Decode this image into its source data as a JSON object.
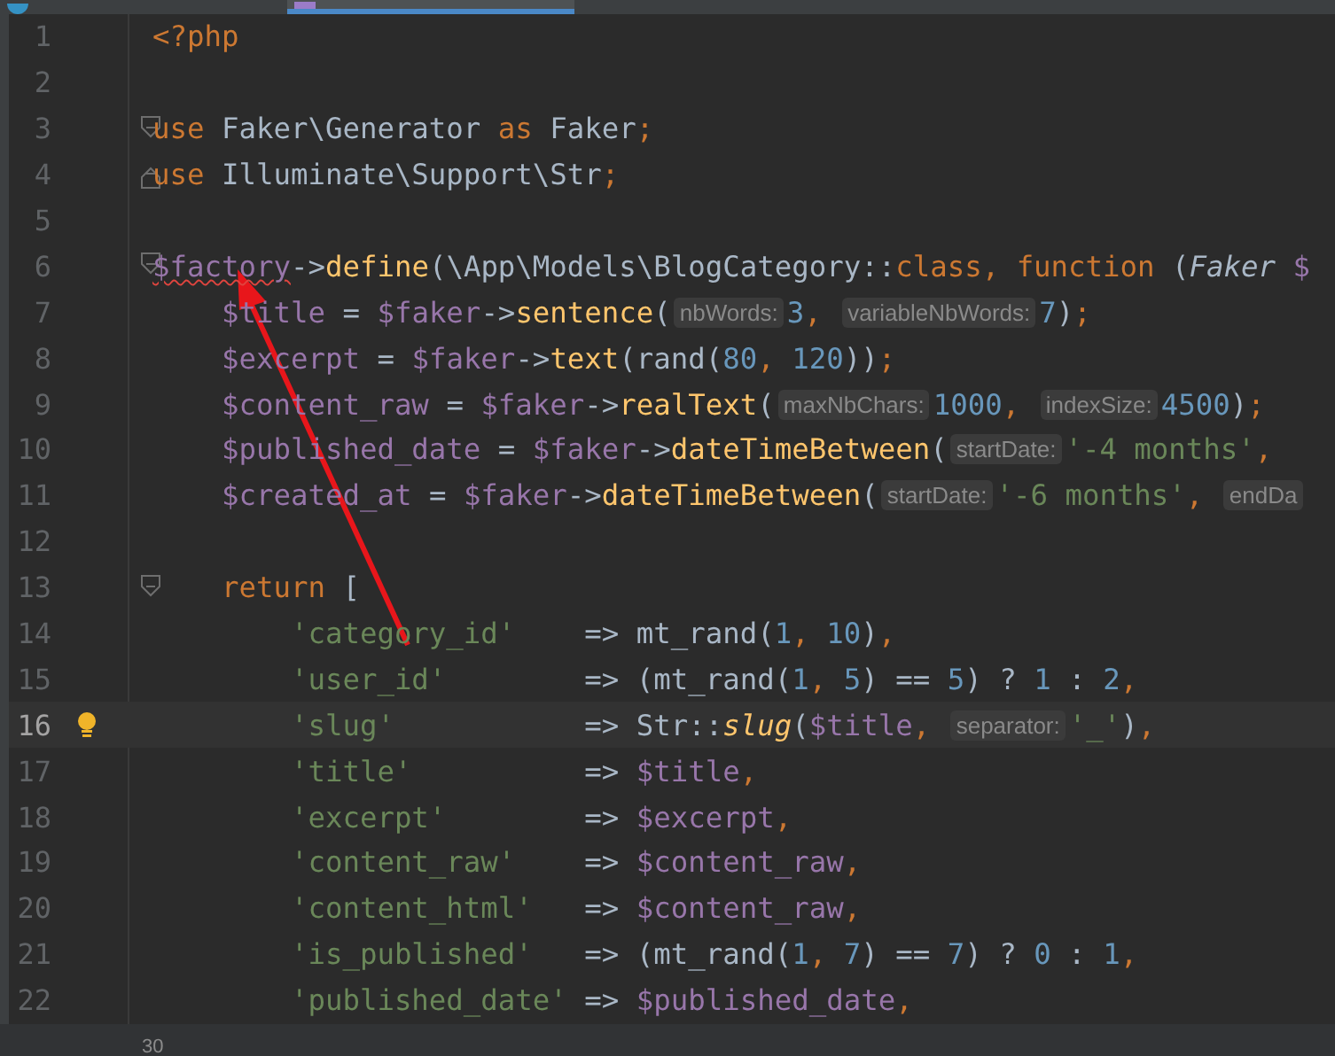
{
  "tabs": [
    {
      "selected": false
    },
    {
      "selected": true
    }
  ],
  "lines": [
    {
      "number": "1",
      "current": false,
      "bulb": false,
      "fold_open": false,
      "fold_close": false,
      "parts": [
        {
          "kind": "kw",
          "t": "<?php"
        }
      ]
    },
    {
      "number": "2",
      "current": false,
      "bulb": false,
      "fold_open": false,
      "fold_close": false
    },
    {
      "number": "3",
      "current": false,
      "bulb": false,
      "fold_open": true,
      "fold_close": false,
      "parts": [
        {
          "kind": "kw",
          "t": "use "
        },
        {
          "kind": "plain",
          "t": "Faker\\Generator "
        },
        {
          "kind": "kw",
          "t": "as "
        },
        {
          "kind": "plain",
          "t": "Faker"
        },
        {
          "kind": "kw",
          "t": ";"
        }
      ]
    },
    {
      "number": "4",
      "current": false,
      "bulb": false,
      "fold_open": false,
      "fold_close": true,
      "parts": [
        {
          "kind": "kw",
          "t": "use "
        },
        {
          "kind": "plain",
          "t": "Illuminate\\Support\\Str"
        },
        {
          "kind": "kw",
          "t": ";"
        }
      ]
    },
    {
      "number": "5",
      "current": false,
      "bulb": false,
      "fold_open": false,
      "fold_close": false
    },
    {
      "number": "6",
      "current": false,
      "bulb": false,
      "fold_open": true,
      "fold_close": false,
      "parts": [
        {
          "kind": "var",
          "t": "$factory",
          "error": true
        },
        {
          "kind": "plain",
          "t": "->"
        },
        {
          "kind": "func",
          "t": "define"
        },
        {
          "kind": "plain",
          "t": "(\\App\\Models\\BlogCategory::"
        },
        {
          "kind": "kw",
          "t": "class, function "
        },
        {
          "kind": "plain",
          "t": "("
        },
        {
          "kind": "class",
          "t": "Faker "
        },
        {
          "kind": "var",
          "t": "$"
        }
      ]
    },
    {
      "number": "7",
      "current": false,
      "bulb": false,
      "fold_open": false,
      "fold_close": false,
      "parts": [
        {
          "kind": "var",
          "t": "    $title "
        },
        {
          "kind": "plain",
          "t": "= "
        },
        {
          "kind": "var",
          "t": "$faker"
        },
        {
          "kind": "plain",
          "t": "->"
        },
        {
          "kind": "func",
          "t": "sentence"
        },
        {
          "kind": "plain",
          "t": "("
        },
        {
          "kind": "hint",
          "t": "nbWords:"
        },
        {
          "kind": "num",
          "t": "3"
        },
        {
          "kind": "kw",
          "t": ", "
        },
        {
          "kind": "hint",
          "t": "variableNbWords:"
        },
        {
          "kind": "num",
          "t": "7"
        },
        {
          "kind": "plain",
          "t": ")"
        },
        {
          "kind": "kw",
          "t": ";"
        }
      ]
    },
    {
      "number": "8",
      "current": false,
      "bulb": false,
      "fold_open": false,
      "fold_close": false,
      "parts": [
        {
          "kind": "var",
          "t": "    $excerpt "
        },
        {
          "kind": "plain",
          "t": "= "
        },
        {
          "kind": "var",
          "t": "$faker"
        },
        {
          "kind": "plain",
          "t": "->"
        },
        {
          "kind": "func",
          "t": "text"
        },
        {
          "kind": "plain",
          "t": "(rand("
        },
        {
          "kind": "num",
          "t": "80"
        },
        {
          "kind": "kw",
          "t": ", "
        },
        {
          "kind": "num",
          "t": "120"
        },
        {
          "kind": "plain",
          "t": "))"
        },
        {
          "kind": "kw",
          "t": ";"
        }
      ]
    },
    {
      "number": "9",
      "current": false,
      "bulb": false,
      "fold_open": false,
      "fold_close": false,
      "parts": [
        {
          "kind": "var",
          "t": "    $content_raw "
        },
        {
          "kind": "plain",
          "t": "= "
        },
        {
          "kind": "var",
          "t": "$faker"
        },
        {
          "kind": "plain",
          "t": "->"
        },
        {
          "kind": "func",
          "t": "realText"
        },
        {
          "kind": "plain",
          "t": "("
        },
        {
          "kind": "hint",
          "t": "maxNbChars:"
        },
        {
          "kind": "num",
          "t": "1000"
        },
        {
          "kind": "kw",
          "t": ", "
        },
        {
          "kind": "hint",
          "t": "indexSize:"
        },
        {
          "kind": "num",
          "t": "4500"
        },
        {
          "kind": "plain",
          "t": ")"
        },
        {
          "kind": "kw",
          "t": ";"
        }
      ]
    },
    {
      "number": "10",
      "current": false,
      "bulb": false,
      "fold_open": false,
      "fold_close": false,
      "parts": [
        {
          "kind": "var",
          "t": "    $published_date "
        },
        {
          "kind": "plain",
          "t": "= "
        },
        {
          "kind": "var",
          "t": "$faker"
        },
        {
          "kind": "plain",
          "t": "->"
        },
        {
          "kind": "func",
          "t": "dateTimeBetween"
        },
        {
          "kind": "plain",
          "t": "("
        },
        {
          "kind": "hint",
          "t": "startDate:"
        },
        {
          "kind": "str",
          "t": "'-4 months'"
        },
        {
          "kind": "kw",
          "t": ", "
        }
      ]
    },
    {
      "number": "11",
      "current": false,
      "bulb": false,
      "fold_open": false,
      "fold_close": false,
      "parts": [
        {
          "kind": "var",
          "t": "    $created_at "
        },
        {
          "kind": "plain",
          "t": "= "
        },
        {
          "kind": "var",
          "t": "$faker"
        },
        {
          "kind": "plain",
          "t": "->"
        },
        {
          "kind": "func",
          "t": "dateTimeBetween"
        },
        {
          "kind": "plain",
          "t": "("
        },
        {
          "kind": "hint",
          "t": "startDate:"
        },
        {
          "kind": "str",
          "t": "'-6 months'"
        },
        {
          "kind": "kw",
          "t": ", "
        },
        {
          "kind": "hint",
          "t": "endDa"
        }
      ]
    },
    {
      "number": "12",
      "current": false,
      "bulb": false,
      "fold_open": false,
      "fold_close": false
    },
    {
      "number": "13",
      "current": false,
      "bulb": false,
      "fold_open": true,
      "fold_close": false,
      "parts": [
        {
          "kind": "kw",
          "t": "    return "
        },
        {
          "kind": "plain",
          "t": "["
        }
      ]
    },
    {
      "number": "14",
      "current": false,
      "bulb": false,
      "fold_open": false,
      "fold_close": false,
      "parts": [
        {
          "kind": "str",
          "t": "        'category_id'"
        },
        {
          "kind": "plain",
          "t": "    => mt_rand("
        },
        {
          "kind": "num",
          "t": "1"
        },
        {
          "kind": "kw",
          "t": ", "
        },
        {
          "kind": "num",
          "t": "10"
        },
        {
          "kind": "plain",
          "t": ")"
        },
        {
          "kind": "kw",
          "t": ","
        }
      ]
    },
    {
      "number": "15",
      "current": false,
      "bulb": false,
      "fold_open": false,
      "fold_close": false,
      "parts": [
        {
          "kind": "str",
          "t": "        'user_id'"
        },
        {
          "kind": "plain",
          "t": "        => (mt_rand("
        },
        {
          "kind": "num",
          "t": "1"
        },
        {
          "kind": "kw",
          "t": ", "
        },
        {
          "kind": "num",
          "t": "5"
        },
        {
          "kind": "plain",
          "t": ") == "
        },
        {
          "kind": "num",
          "t": "5"
        },
        {
          "kind": "plain",
          "t": ") ? "
        },
        {
          "kind": "num",
          "t": "1"
        },
        {
          "kind": "plain",
          "t": " : "
        },
        {
          "kind": "num",
          "t": "2"
        },
        {
          "kind": "kw",
          "t": ","
        }
      ]
    },
    {
      "number": "16",
      "current": true,
      "bulb": true,
      "fold_open": false,
      "fold_close": false,
      "parts": [
        {
          "kind": "str",
          "t": "        'slug'"
        },
        {
          "kind": "plain",
          "t": "           => Str::"
        },
        {
          "kind": "ifunc",
          "t": "slug"
        },
        {
          "kind": "plain",
          "t": "("
        },
        {
          "kind": "var",
          "t": "$title"
        },
        {
          "kind": "kw",
          "t": ", "
        },
        {
          "kind": "hint",
          "t": "separator:"
        },
        {
          "kind": "str",
          "t": "'_'"
        },
        {
          "kind": "plain",
          "t": ")"
        },
        {
          "kind": "kw",
          "t": ","
        }
      ]
    },
    {
      "number": "17",
      "current": false,
      "bulb": false,
      "fold_open": false,
      "fold_close": false,
      "parts": [
        {
          "kind": "str",
          "t": "        'title'"
        },
        {
          "kind": "plain",
          "t": "          => "
        },
        {
          "kind": "var",
          "t": "$title"
        },
        {
          "kind": "kw",
          "t": ","
        }
      ]
    },
    {
      "number": "18",
      "current": false,
      "bulb": false,
      "fold_open": false,
      "fold_close": false,
      "parts": [
        {
          "kind": "str",
          "t": "        'excerpt'"
        },
        {
          "kind": "plain",
          "t": "        => "
        },
        {
          "kind": "var",
          "t": "$excerpt"
        },
        {
          "kind": "kw",
          "t": ","
        }
      ]
    },
    {
      "number": "19",
      "current": false,
      "bulb": false,
      "fold_open": false,
      "fold_close": false,
      "parts": [
        {
          "kind": "str",
          "t": "        'content_raw'"
        },
        {
          "kind": "plain",
          "t": "    => "
        },
        {
          "kind": "var",
          "t": "$content_raw"
        },
        {
          "kind": "kw",
          "t": ","
        }
      ]
    },
    {
      "number": "20",
      "current": false,
      "bulb": false,
      "fold_open": false,
      "fold_close": false,
      "parts": [
        {
          "kind": "str",
          "t": "        'content_html'"
        },
        {
          "kind": "plain",
          "t": "   => "
        },
        {
          "kind": "var",
          "t": "$content_raw"
        },
        {
          "kind": "kw",
          "t": ","
        }
      ]
    },
    {
      "number": "21",
      "current": false,
      "bulb": false,
      "fold_open": false,
      "fold_close": false,
      "parts": [
        {
          "kind": "str",
          "t": "        'is_published'"
        },
        {
          "kind": "plain",
          "t": "   => (mt_rand("
        },
        {
          "kind": "num",
          "t": "1"
        },
        {
          "kind": "kw",
          "t": ", "
        },
        {
          "kind": "num",
          "t": "7"
        },
        {
          "kind": "plain",
          "t": ") == "
        },
        {
          "kind": "num",
          "t": "7"
        },
        {
          "kind": "plain",
          "t": ") ? "
        },
        {
          "kind": "num",
          "t": "0"
        },
        {
          "kind": "plain",
          "t": " : "
        },
        {
          "kind": "num",
          "t": "1"
        },
        {
          "kind": "kw",
          "t": ","
        }
      ]
    },
    {
      "number": "22",
      "current": false,
      "bulb": false,
      "fold_open": false,
      "fold_close": false,
      "parts": [
        {
          "kind": "str",
          "t": "        'published_date'"
        },
        {
          "kind": "plain",
          "t": " => "
        },
        {
          "kind": "var",
          "t": "$published_date"
        },
        {
          "kind": "kw",
          "t": ","
        }
      ]
    }
  ],
  "breadcrumb": "30",
  "annotations": [
    {
      "kind": "arrow"
    }
  ]
}
